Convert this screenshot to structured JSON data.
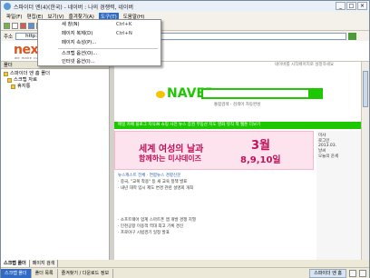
{
  "window": {
    "title": "스파이더 엔(4)(한국) - 네이버 : 나의 경쟁력, 네이버",
    "buttons": [
      "_",
      "□",
      "×"
    ]
  },
  "menubar": {
    "items": [
      "파일(F)",
      "편집(E)",
      "보기(V)",
      "즐겨찾기(A)",
      "도구(T)",
      "도움말(H)"
    ],
    "open_index": 4
  },
  "address": {
    "label": "주소",
    "value": "http://www.naver.com/"
  },
  "brand": {
    "logo_left": "nex",
    "logo_right": "soft",
    "tagline": "we make culture"
  },
  "tools_menu": {
    "items": [
      {
        "label": "새 창(N)",
        "shortcut": "Ctrl+K"
      },
      {
        "label": "페이지 복제(D)",
        "shortcut": "Ctrl+N"
      },
      {
        "label": "페이지 속성(P)...",
        "shortcut": ""
      },
      {
        "label": "스크랩 옵션(O)...",
        "shortcut": ""
      },
      {
        "label": "인터넷 옵션(I)...",
        "shortcut": ""
      }
    ]
  },
  "left_panel": {
    "header": "폴더",
    "tree": [
      "스파이더 엔 홈 폴더",
      "스크랩 자료",
      "휴지통"
    ]
  },
  "page": {
    "top_link": "네이버를 시작페이지로 설정하세요",
    "logo": "NAVER",
    "search_sub": "통합검색 · 검색어 자동완성",
    "green_nav": "메일  카페  블로그  지식iN  쇼핑  사전  뉴스  증권  부동산  지도  영화  뮤직  책  웹툰  더보기",
    "ad_line1": "세계 여성의 날과",
    "ad_line2": "함께하는 미샤데이즈",
    "ad_month": "3월",
    "ad_dates": "8,9,10일",
    "news_headline": "뉴스캐스트  전체 · 연합뉴스  경향신문",
    "news_items": [
      "· 중국, \"교복 착용\" 등 새 교육 정책 발표",
      "· 내년 대학 입시 제도 변경 관련 설명회 개최",
      "· 소프트웨어 업계 스마트폰 앱 개발 경쟁 치열",
      "· 인천공항 이용객 역대 최고 기록 경신",
      "· 프로야구 시범경기 일정 발표"
    ],
    "right_col": [
      "미샤",
      "로그인",
      "2013.03.",
      "날씨",
      "오늘의 운세"
    ]
  },
  "bottom_tabs": {
    "items": [
      "스크랩 폴더",
      "페이지 검색"
    ],
    "active": 0
  },
  "statusbar": {
    "left": [
      "스크랩 폴더",
      "폴더 목록",
      "즐겨찾기 / 다운로드 정보"
    ],
    "right_status": "스파이더 엔 홈"
  }
}
